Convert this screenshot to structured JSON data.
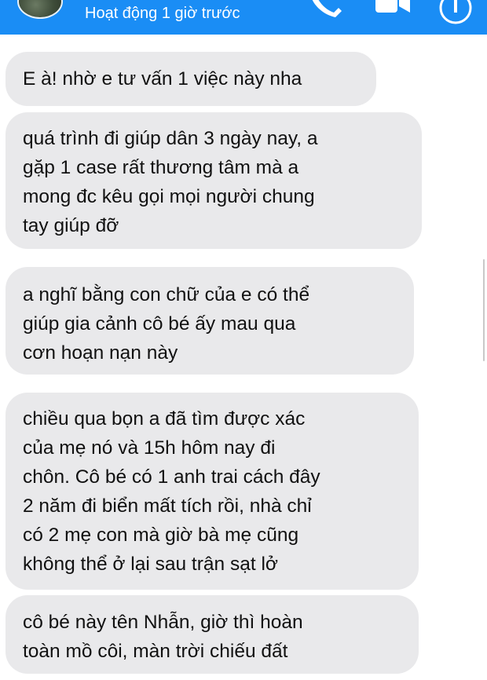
{
  "header": {
    "status": "Hoạt động 1 giờ trước",
    "icons": [
      "avatar",
      "phone-icon",
      "video-icon",
      "info-icon"
    ],
    "accent_color": "#1a8df5"
  },
  "messages": [
    {
      "lines": [
        "E à! nhờ e tư vấn 1 việc này nha"
      ]
    },
    {
      "lines": [
        "quá trình đi giúp dân 3 ngày nay, a",
        "gặp 1 case rất thương tâm mà a",
        "mong đc kêu gọi mọi người chung",
        "tay giúp đỡ"
      ]
    },
    {
      "lines": [
        "a nghĩ bằng con chữ của e có thể",
        "giúp gia cảnh cô bé ấy mau qua",
        "cơn hoạn nạn này"
      ]
    },
    {
      "lines": [
        "chiều qua bọn a đã tìm được xác",
        "của mẹ nó và 15h hôm nay đi",
        "chôn. Cô bé có 1 anh trai cách đây",
        "2 năm đi biển mất tích rồi, nhà chỉ",
        "có 2 mẹ con mà giờ bà mẹ cũng",
        "không thể ở lại sau trận sạt lở"
      ]
    },
    {
      "lines": [
        "cô bé này tên Nhẫn, giờ thì hoàn",
        "toàn mồ côi, màn trời chiếu đất"
      ]
    }
  ],
  "bubble_color": "#e9e9eb"
}
